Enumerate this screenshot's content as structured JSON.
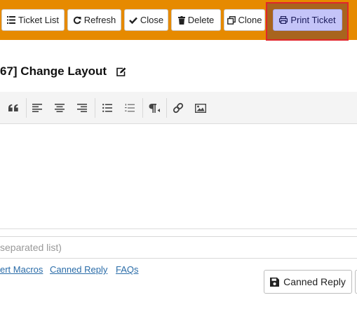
{
  "toolbar": {
    "ticket_list": "Ticket List",
    "refresh": "Refresh",
    "close": "Close",
    "delete": "Delete",
    "clone": "Clone",
    "print_ticket": "Print Ticket"
  },
  "colors": {
    "toolbar_bg": "#e68a00",
    "print_button_bg": "#c4c4f8",
    "highlight_border": "#e0262c",
    "link": "#2a6ca8"
  },
  "ticket": {
    "title": "67] Change Layout"
  },
  "editor": {
    "toolbar_icons": [
      "blockquote-icon",
      "align-left-icon",
      "align-center-icon",
      "align-right-icon",
      "bulleted-list-icon",
      "numbered-list-icon",
      "paragraph-direction-icon",
      "link-icon",
      "image-icon"
    ]
  },
  "tags": {
    "placeholder": "separated list)"
  },
  "links": {
    "macros": "ert Macros",
    "canned_reply": "Canned Reply",
    "faqs": "FAQs"
  },
  "actions": {
    "canned_reply_button": "Canned Reply"
  }
}
